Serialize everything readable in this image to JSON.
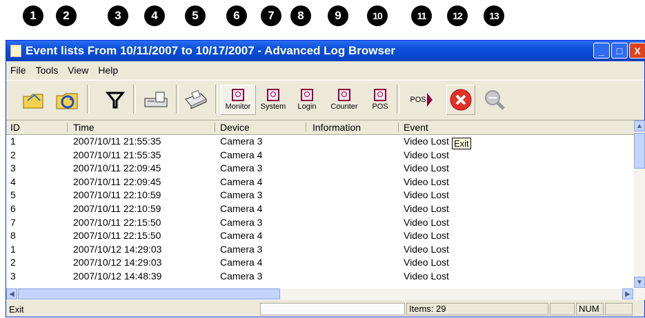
{
  "callouts": [
    "1",
    "2",
    "3",
    "4",
    "5",
    "6",
    "7",
    "8",
    "9",
    "10",
    "11",
    "12",
    "13"
  ],
  "window": {
    "title": "Event lists From 10/11/2007 to 10/17/2007 - Advanced Log Browser",
    "controls": {
      "minimize": "_",
      "maximize": "□",
      "close": "X"
    }
  },
  "menu": [
    "File",
    "Tools",
    "View",
    "Help"
  ],
  "toolbar": {
    "monitor": "Monitor",
    "system": "System",
    "login": "Login",
    "counter": "Counter",
    "pos": "POS",
    "pos_forward": "POS",
    "icons": [
      "open-folder-icon",
      "refresh-folder-icon",
      "filter-icon",
      "export-icon",
      "print-icon",
      "monitor-record-icon",
      "system-record-icon",
      "login-record-icon",
      "counter-record-icon",
      "pos-record-icon",
      "pos-arrow-icon",
      "exit-icon",
      "search-disabled-icon"
    ]
  },
  "table": {
    "columns": [
      "ID",
      "Time",
      "Device",
      "Information",
      "Event"
    ],
    "rows": [
      [
        "1",
        "2007/10/11 21:55:35",
        "Camera 3",
        "",
        "Video Lost"
      ],
      [
        "2",
        "2007/10/11 21:55:35",
        "Camera 4",
        "",
        "Video Lost"
      ],
      [
        "3",
        "2007/10/11 22:09:45",
        "Camera 3",
        "",
        "Video Lost"
      ],
      [
        "4",
        "2007/10/11 22:09:45",
        "Camera 4",
        "",
        "Video Lost"
      ],
      [
        "5",
        "2007/10/11 22:10:59",
        "Camera 3",
        "",
        "Video Lost"
      ],
      [
        "6",
        "2007/10/11 22:10:59",
        "Camera 4",
        "",
        "Video Lost"
      ],
      [
        "7",
        "2007/10/11 22:15:50",
        "Camera 3",
        "",
        "Video Lost"
      ],
      [
        "8",
        "2007/10/11 22:15:50",
        "Camera 4",
        "",
        "Video Lost"
      ],
      [
        "1",
        "2007/10/12 14:29:03",
        "Camera 3",
        "",
        "Video Lost"
      ],
      [
        "2",
        "2007/10/12 14:29:03",
        "Camera 4",
        "",
        "Video Lost"
      ],
      [
        "3",
        "2007/10/12 14:48:39",
        "Camera 3",
        "",
        "Video Lost"
      ]
    ]
  },
  "tooltip": "Exit",
  "status": {
    "message": "Exit",
    "items": "Items: 29",
    "num": "NUM"
  },
  "colors": {
    "titlebar": "#0a4fd8",
    "close": "#e03020",
    "record": "#8a0040"
  }
}
